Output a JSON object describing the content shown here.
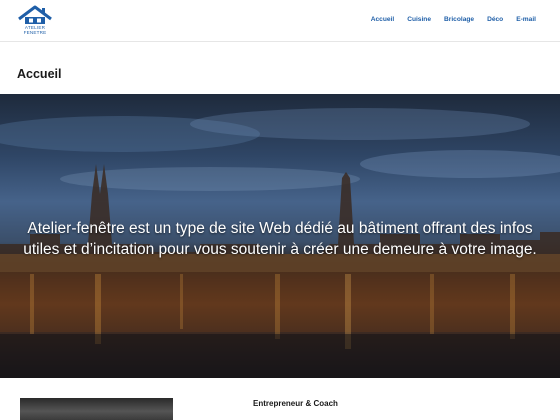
{
  "header": {
    "logo": {
      "line1": "ATELIER",
      "line2": "FENETRE",
      "icon": "house-roof-icon",
      "color": "#1f5fa8"
    },
    "nav": [
      {
        "label": "Accueil"
      },
      {
        "label": "Cuisine"
      },
      {
        "label": "Bricolage"
      },
      {
        "label": "Déco"
      },
      {
        "label": "E-mail"
      }
    ]
  },
  "main": {
    "title": "Accueil",
    "hero": {
      "text": "Atelier-fenêtre est un type de site Web dédié au bâtiment offrant des infos utiles et d’incitation pour vous soutenir à créer une demeure à votre image."
    },
    "post": {
      "heading": "Entrepreneur & Coach"
    }
  },
  "colors": {
    "accent": "#1f5fa8",
    "text": "#1a1a1a"
  }
}
